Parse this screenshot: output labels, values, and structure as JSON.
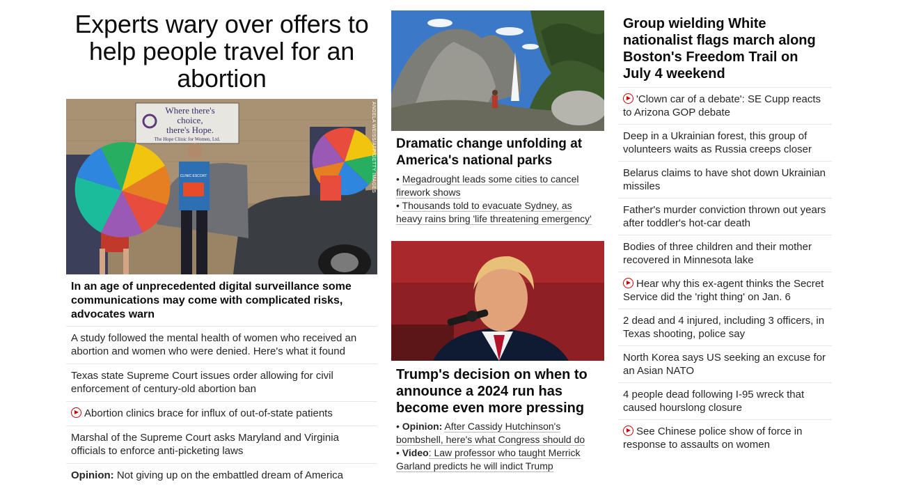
{
  "left": {
    "hero_title": "Experts wary over offers to help people travel for an abortion",
    "image_credit": "ANGELA WEISS/AFP/GETTY IMAGES",
    "sign_line1": "Where there's",
    "sign_line2": "choice,",
    "sign_line3": "there's Hope.",
    "sign_line4": "The Hope Clinic for Women, Ltd.",
    "vest_text": "CLINIC ESCORT",
    "headline": "In an age of unprecedented digital surveillance some communications may come with complicated risks, advocates warn",
    "items": [
      {
        "text": "A study followed the mental health of women who received an abortion and women who were denied. Here's what it found"
      },
      {
        "text": "Texas state Supreme Court issues order allowing for civil enforcement of century-old abortion ban"
      },
      {
        "text": "Abortion clinics brace for influx of out-of-state patients",
        "video": true
      },
      {
        "text": "Marshal of the Supreme Court asks Maryland and Virginia officials to enforce anti-picketing laws"
      },
      {
        "label": "Opinion:",
        "text": " Not giving up on the embattled dream of America"
      }
    ]
  },
  "middle": {
    "story1": {
      "headline": "Dramatic change unfolding at America's national parks",
      "bullets": [
        "Megadrought leads some cities to cancel firework shows",
        "Thousands told to evacuate Sydney, as heavy rains bring 'life threatening emergency'"
      ]
    },
    "story2": {
      "headline": "Trump's decision on when to announce a 2024 run has become even more pressing",
      "bullets": [
        {
          "label": "Opinion:",
          "text": "After Cassidy Hutchinson's bombshell, here's what Congress should do"
        },
        {
          "label": "Video",
          "text": ": Law professor who taught Merrick Garland predicts he will indict Trump"
        }
      ]
    }
  },
  "right": {
    "headline": "Group wielding White nationalist flags march along Boston's Freedom Trail on July 4 weekend",
    "items": [
      {
        "text": "'Clown car of a debate': SE Cupp reacts to Arizona GOP debate",
        "video": true
      },
      {
        "text": "Deep in a Ukrainian forest, this group of volunteers waits as Russia creeps closer"
      },
      {
        "text": "Belarus claims to have shot down Ukrainian missiles"
      },
      {
        "text": "Father's murder conviction thrown out years after toddler's hot-car death"
      },
      {
        "text": "Bodies of three children and their mother recovered in Minnesota lake"
      },
      {
        "text": "Hear why this ex-agent thinks the Secret Service did the 'right thing' on Jan. 6",
        "video": true
      },
      {
        "text": "2 dead and 4 injured, including 3 officers, in Texas shooting, police say"
      },
      {
        "text": "North Korea says US seeking an excuse for an Asian NATO"
      },
      {
        "text": "4 people dead following I-95 wreck that caused hourslong closure"
      },
      {
        "text": "See Chinese police show of force in response to assaults on women",
        "video": true
      }
    ]
  },
  "colors": {
    "video_red": "#cc0000",
    "headline": "#0c0c0c",
    "body": "#262626",
    "divider": "#e6e6e6"
  }
}
